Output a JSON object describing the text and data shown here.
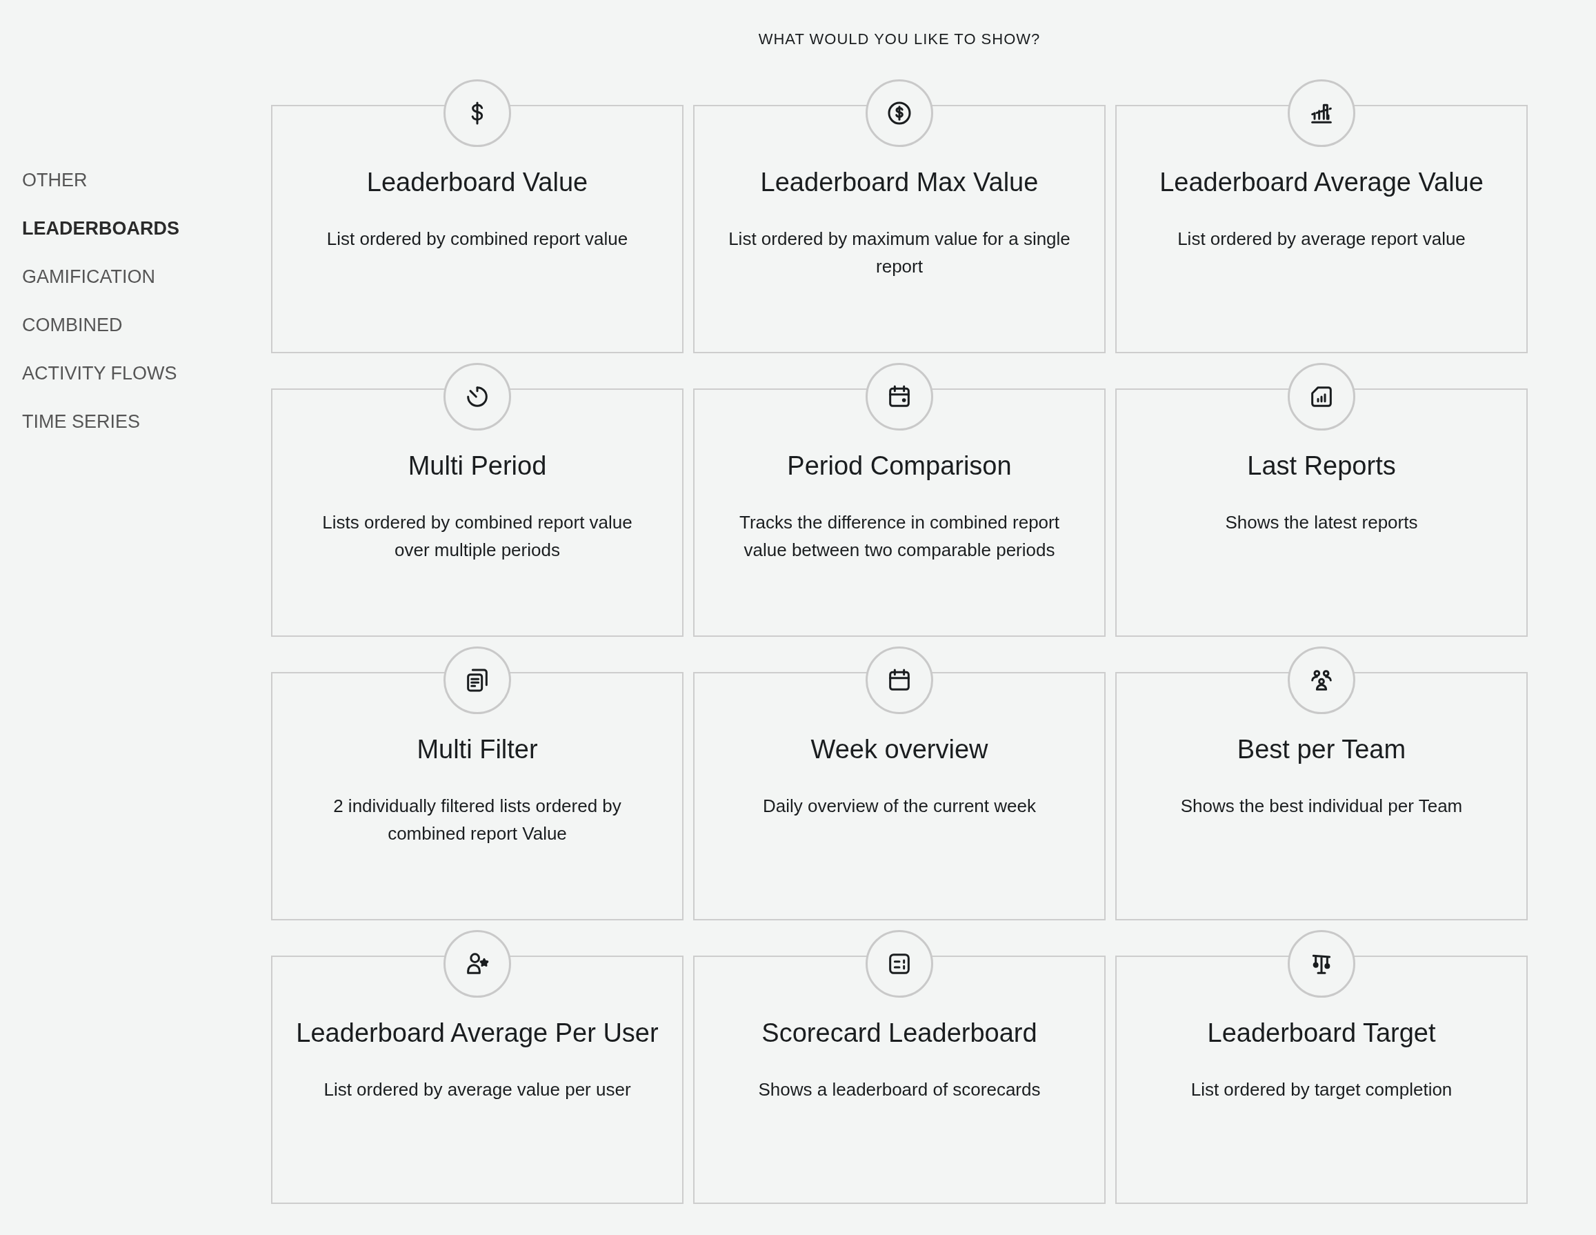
{
  "heading": "WHAT WOULD YOU LIKE TO SHOW?",
  "sidebar": {
    "items": [
      {
        "label": "OTHER",
        "selected": false
      },
      {
        "label": "LEADERBOARDS",
        "selected": true
      },
      {
        "label": "GAMIFICATION",
        "selected": false
      },
      {
        "label": "COMBINED",
        "selected": false
      },
      {
        "label": "ACTIVITY FLOWS",
        "selected": false
      },
      {
        "label": "TIME SERIES",
        "selected": false
      }
    ]
  },
  "cards": [
    {
      "title": "Leaderboard Value",
      "description": "List ordered by combined report value"
    },
    {
      "title": "Leaderboard Max Value",
      "description": "List ordered by maximum value for a single report"
    },
    {
      "title": "Leaderboard Average Value",
      "description": "List ordered by average report value"
    },
    {
      "title": "Multi Period",
      "description": "Lists ordered by combined report value over multiple periods"
    },
    {
      "title": "Period Comparison",
      "description": "Tracks the difference in combined report value between two comparable periods"
    },
    {
      "title": "Last Reports",
      "description": "Shows the latest reports"
    },
    {
      "title": "Multi Filter",
      "description": "2 individually filtered lists ordered by combined report Value"
    },
    {
      "title": "Week overview",
      "description": "Daily overview of the current week"
    },
    {
      "title": "Best per Team",
      "description": "Shows the best individual per Team"
    },
    {
      "title": "Leaderboard Average Per User",
      "description": "List ordered by average value per user"
    },
    {
      "title": "Scorecard Leaderboard",
      "description": "Shows a leaderboard of scorecards"
    },
    {
      "title": "Leaderboard Target",
      "description": "List ordered by target completion"
    }
  ]
}
